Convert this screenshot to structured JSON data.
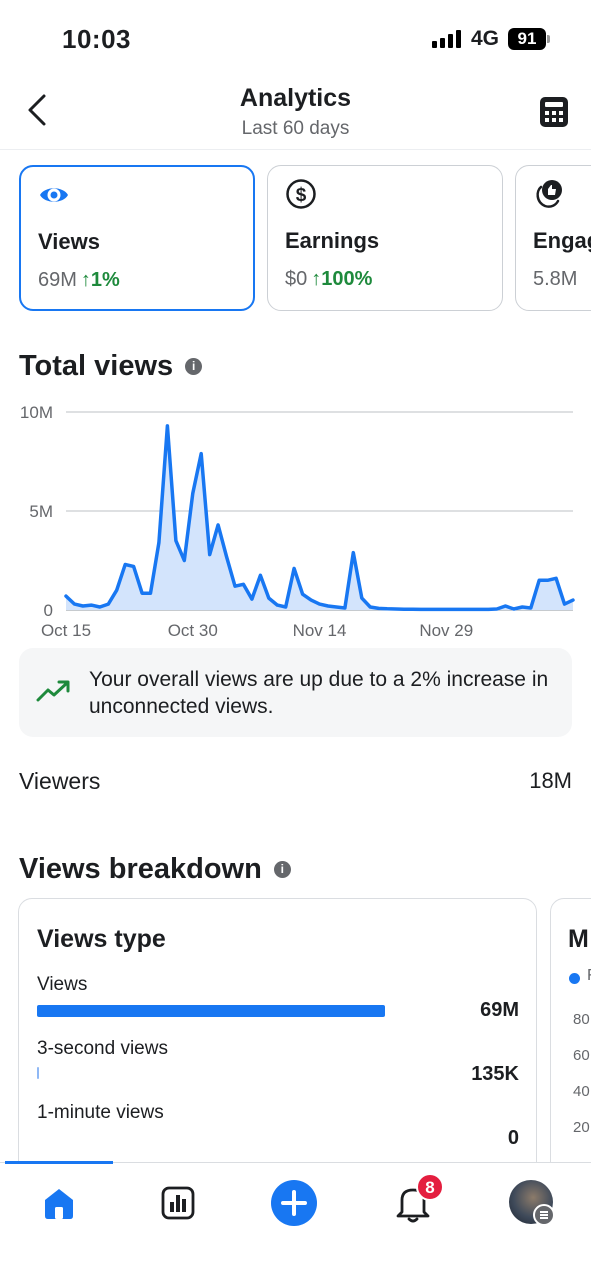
{
  "status_bar": {
    "time": "10:03",
    "network": "4G",
    "battery": "91"
  },
  "header": {
    "title": "Analytics",
    "subtitle": "Last 60 days"
  },
  "metrics": [
    {
      "label": "Views",
      "value": "69M",
      "change": "↑1%",
      "icon": "eye-icon",
      "selected": true
    },
    {
      "label": "Earnings",
      "value": "$0",
      "change": "↑100%",
      "icon": "dollar-icon",
      "selected": false
    },
    {
      "label": "Engag",
      "value": "5.8M",
      "change": "",
      "icon": "thumbs-up-icon",
      "selected": false
    }
  ],
  "total_views": {
    "title": "Total views",
    "chart_data": {
      "type": "area",
      "title": "Total views",
      "y_ticks": [
        "10M",
        "5M",
        "0"
      ],
      "x_ticks": [
        "Oct 15",
        "Oct 30",
        "Nov 14",
        "Nov 29"
      ],
      "ylim": [
        0,
        10000000
      ],
      "grid": true,
      "series": [
        {
          "values": [
            0.7,
            0.3,
            0.2,
            0.25,
            0.15,
            0.3,
            1.0,
            2.3,
            2.2,
            0.85,
            0.85,
            3.4,
            9.3,
            3.5,
            2.5,
            5.9,
            7.9,
            2.8,
            4.3,
            2.7,
            1.2,
            1.3,
            0.55,
            1.75,
            0.6,
            0.25,
            0.15,
            2.1,
            0.8,
            0.5,
            0.3,
            0.2,
            0.15,
            0.1,
            2.9,
            0.6,
            0.15,
            0.08,
            0.06,
            0.05,
            0.04,
            0.04,
            0.03,
            0.03,
            0.03,
            0.03,
            0.03,
            0.03,
            0.03,
            0.03,
            0.03,
            0.05,
            0.2,
            0.05,
            0.15,
            0.1,
            1.5,
            1.5,
            1.6,
            0.3,
            0.5
          ],
          "color": "#1877f2"
        }
      ]
    }
  },
  "insight": {
    "text": "Your overall views are up due to a 2% increase in unconnected views."
  },
  "viewers": {
    "label": "Viewers",
    "value": "18M"
  },
  "views_breakdown": {
    "title": "Views breakdown",
    "card1": {
      "title": "Views type",
      "rows": [
        {
          "label": "Views",
          "value": "69M",
          "fraction": 1.0
        },
        {
          "label": "3-second views",
          "value": "135K",
          "fraction": 0.002
        },
        {
          "label": "1-minute views",
          "value": "0",
          "fraction": 0
        }
      ]
    },
    "card2": {
      "title": "M",
      "legend": "F",
      "ticks": [
        "80",
        "60",
        "40",
        "20"
      ]
    }
  },
  "tab_bar": {
    "notification_count": "8"
  },
  "colors": {
    "accent": "#1877f2",
    "positive": "#1e8a3c",
    "badge": "#e41e3f"
  }
}
